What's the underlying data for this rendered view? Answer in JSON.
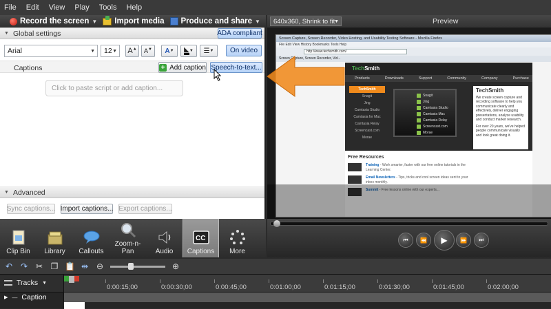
{
  "menu": [
    "File",
    "Edit",
    "View",
    "Play",
    "Tools",
    "Help"
  ],
  "toolbar": {
    "record": "Record the screen",
    "import": "Import media",
    "produce": "Produce and share"
  },
  "preview": {
    "size_option": "640x360, Shrink to fit",
    "title": "Preview"
  },
  "captions_panel": {
    "global_settings": "Global settings",
    "ada": "ADA compliant",
    "font": "Arial",
    "font_size": "12",
    "on_video": "On video",
    "captions_label": "Captions",
    "add_caption": "Add caption",
    "speech_to_text": "Speech-to-text...",
    "script_placeholder": "Click to paste script or add caption...",
    "advanced": "Advanced",
    "sync": "Sync captions...",
    "import": "Import captions...",
    "export": "Export captions..."
  },
  "tabs": [
    {
      "label": "Clip Bin"
    },
    {
      "label": "Library"
    },
    {
      "label": "Callouts"
    },
    {
      "label": "Zoom-n-\nPan"
    },
    {
      "label": "Audio"
    },
    {
      "label": "Captions"
    },
    {
      "label": "More"
    }
  ],
  "browser": {
    "title": "Screen Capture, Screen Recorder, Video Hosting, and Usability Testing Software - Mozilla Firefox",
    "menu": "File  Edit  View  History  Bookmarks  Tools  Help",
    "url": "http://www.techsmith.com/",
    "tab": "Screen Capture, Screen Recorder, Vid..."
  },
  "site": {
    "logo_a": "Tech",
    "logo_b": "Smith",
    "nav": [
      "Products",
      "Downloads",
      "Support",
      "Community",
      "Company",
      "Purchase"
    ],
    "sidebar": [
      "TechSmith",
      "Snagit",
      "Jing",
      "Camtasia Studio",
      "Camtasia for Mac",
      "Camtasia Relay",
      "Screencast.com",
      "Morae"
    ],
    "products": [
      "Snagit",
      "Jing",
      "Camtasia Studio",
      "Camtasia Mac",
      "Camtasia Relay",
      "Screencast.com",
      "Morae"
    ],
    "card_logo": "TechSmith",
    "card_text": "We create screen capture and recording software to help you communicate clearly and effectively, deliver engaging presentations, analyze usability and conduct market research.",
    "card_text2": "For over 20 years, we've helped people communicate visually and look great doing it.",
    "free_title": "Free Resources",
    "free_rows": [
      {
        "head": "Training",
        "text": " - Work smarter, faster with our free online tutorials in the Learning Center."
      },
      {
        "head": "Email Newsletters",
        "text": " - Tips, tricks and cool screen ideas sent to your inbox monthly."
      },
      {
        "head": "Summit",
        "text": " - Free lessons online with our experts..."
      }
    ]
  },
  "timeline": {
    "tracks_label": "Tracks",
    "caption_track": "Caption",
    "ticks": [
      "0:00:15;00",
      "0:00:30;00",
      "0:00:45;00",
      "0:01:00;00",
      "0:01:15;00",
      "0:01:30;00",
      "0:01:45;00",
      "0:02:00;00"
    ]
  },
  "colors": {
    "accent_orange": "#f08a1c",
    "ada_blue": "#b7d3f7"
  }
}
